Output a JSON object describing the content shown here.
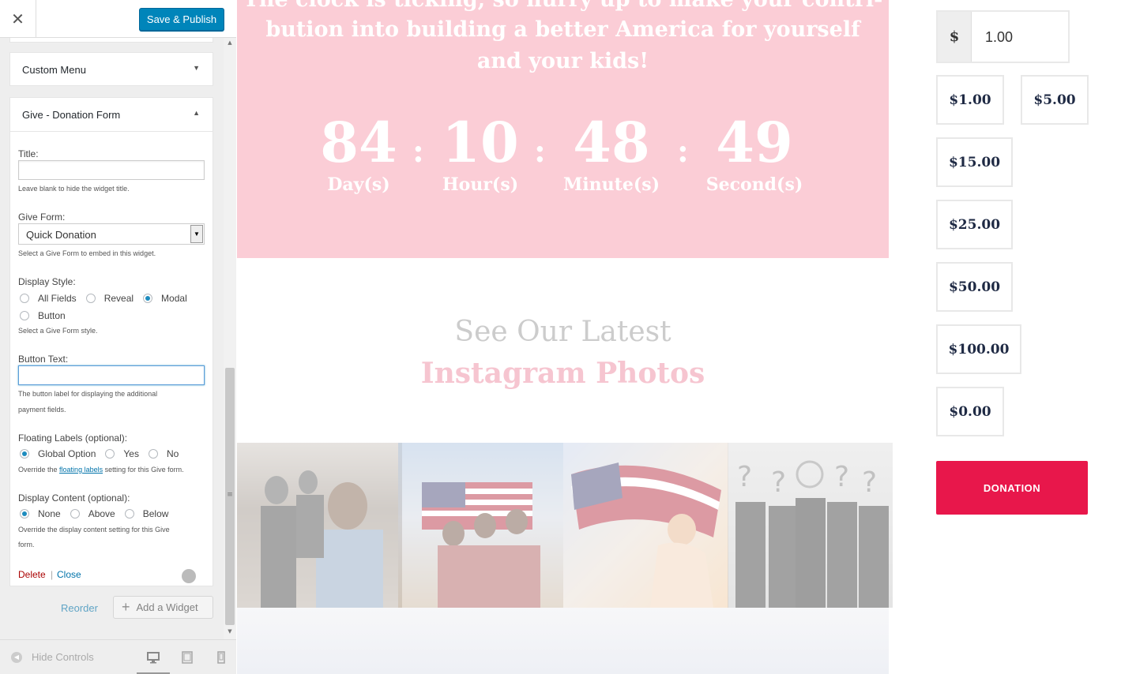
{
  "customizer": {
    "close_glyph": "✕",
    "save_label": "Save & Publish",
    "widgets": {
      "custom_menu_title": "Custom Menu",
      "give_title": "Give - Donation Form"
    },
    "give_form": {
      "title_label": "Title:",
      "title_value": "",
      "title_help": "Leave blank to hide the widget title.",
      "form_label": "Give Form:",
      "form_selected": "Quick Donation",
      "form_help": "Select a Give Form to embed in this widget.",
      "display_style_label": "Display Style:",
      "display_style_options": [
        "All Fields",
        "Reveal",
        "Modal",
        "Button"
      ],
      "display_style_selected": "Modal",
      "display_style_help": "Select a Give Form style.",
      "button_text_label": "Button Text:",
      "button_text_value": "",
      "button_text_help_1": "The button label for displaying the additional",
      "button_text_help_2": "payment fields.",
      "floating_label": "Floating Labels (optional):",
      "floating_options": [
        "Global Option",
        "Yes",
        "No"
      ],
      "floating_selected": "Global Option",
      "floating_help_pre": "Override the",
      "floating_help_link": "floating labels",
      "floating_help_post": "setting for this Give form.",
      "display_content_label": "Display Content (optional):",
      "display_content_options": [
        "None",
        "Above",
        "Below"
      ],
      "display_content_selected": "None",
      "display_content_help_1": "Override the display content setting for this Give",
      "display_content_help_2": "form.",
      "delete_label": "Delete",
      "separator": "|",
      "close_label": "Close"
    },
    "reorder_label": "Reorder",
    "add_widget_label": "Add a Widget",
    "hide_controls_label": "Hide Controls",
    "devices": [
      "desktop-icon",
      "tablet-icon",
      "mobile-icon"
    ]
  },
  "preview": {
    "hero_lines": [
      "The clock is ticking, so hurry up to make your contri-",
      "bution into building a better America for yourself",
      "and your kids!"
    ],
    "countdown": [
      {
        "value": "84",
        "label": "Day(s)"
      },
      {
        "value": "10",
        "label": "Hour(s)"
      },
      {
        "value": "48",
        "label": "Minute(s)"
      },
      {
        "value": "49",
        "label": "Second(s)"
      }
    ],
    "countdown_sep": ":",
    "instagram_heading_1": "See Our Latest",
    "instagram_heading_2": "Instagram Photos",
    "colors": {
      "hero_bg": "#fbcdd6",
      "donate_bg": "#e8174b",
      "accent_blue": "#0085ba"
    }
  },
  "donation": {
    "currency_symbol": "$",
    "amount_value": "1.00",
    "levels": [
      "$1.00",
      "$5.00",
      "$15.00",
      "$25.00",
      "$50.00",
      "$100.00",
      "$0.00"
    ],
    "donate_label": "DONATION"
  }
}
